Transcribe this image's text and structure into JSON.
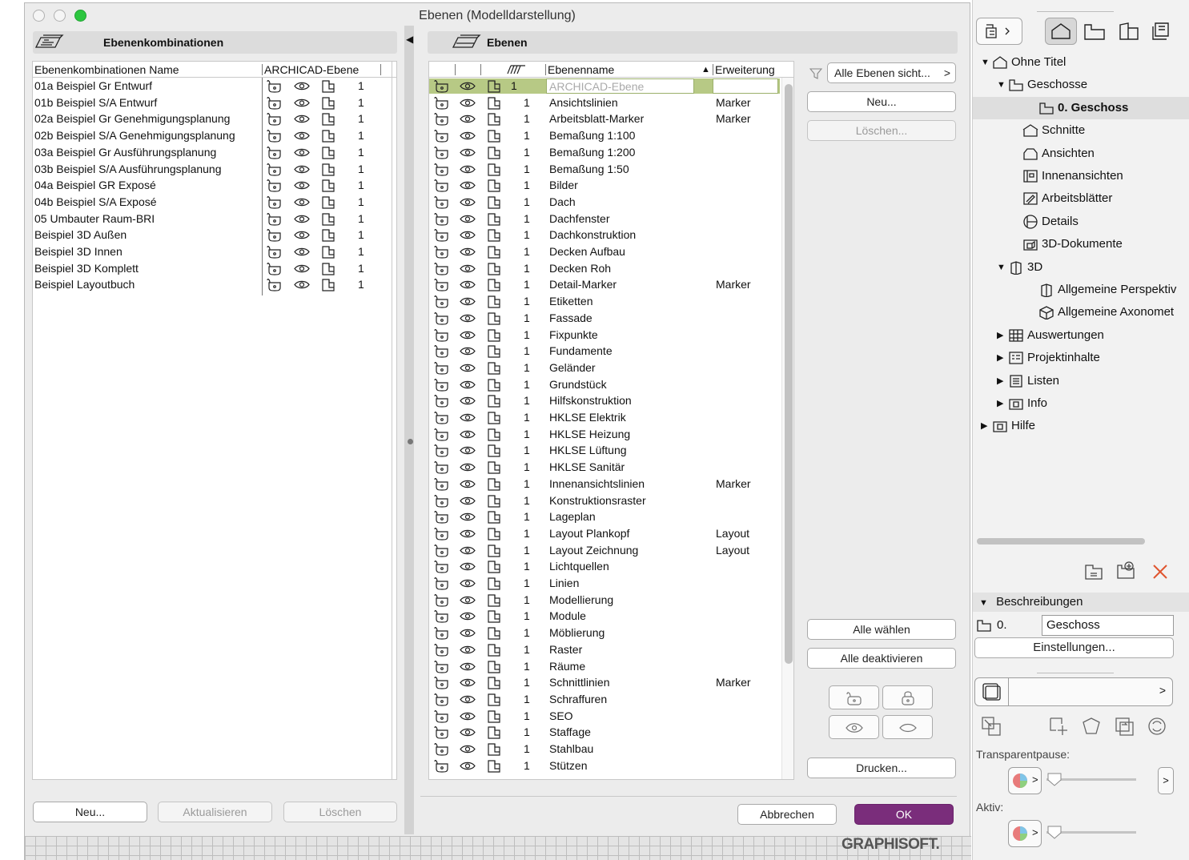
{
  "window": {
    "title": "Ebenen (Modelldarstellung)"
  },
  "left_panel": {
    "header": "Ebenenkombinationen",
    "columns": [
      "Ebenenkombinationen Name",
      "ARCHICAD-Ebene"
    ],
    "rows": [
      {
        "name": "01a Beispiel Gr Entwurf",
        "num": "1"
      },
      {
        "name": "01b Beispiel S/A Entwurf",
        "num": "1"
      },
      {
        "name": "02a Beispiel Gr Genehmigungsplanung",
        "num": "1"
      },
      {
        "name": "02b Beispiel S/A Genehmigungsplanung",
        "num": "1"
      },
      {
        "name": "03a Beispiel Gr Ausführungsplanung",
        "num": "1"
      },
      {
        "name": "03b Beispiel S/A Ausführungsplanung",
        "num": "1"
      },
      {
        "name": "04a Beispiel GR Exposé",
        "num": "1"
      },
      {
        "name": "04b Beispiel S/A Exposé",
        "num": "1"
      },
      {
        "name": "05 Umbauter Raum-BRI",
        "num": "1"
      },
      {
        "name": "Beispiel 3D Außen",
        "num": "1"
      },
      {
        "name": "Beispiel 3D Innen",
        "num": "1"
      },
      {
        "name": "Beispiel 3D Komplett",
        "num": "1"
      },
      {
        "name": "Beispiel Layoutbuch",
        "num": "1"
      }
    ],
    "buttons": {
      "new": "Neu...",
      "update": "Aktualisieren",
      "delete": "Löschen"
    }
  },
  "right_panel": {
    "header": "Ebenen",
    "columns": {
      "name": "Ebenenname",
      "sort": "▲",
      "ext": "Erweiterung"
    },
    "rows": [
      {
        "num": "1",
        "name": "ARCHICAD-Ebene",
        "ext": "",
        "selected": true
      },
      {
        "num": "1",
        "name": "Ansichtslinien",
        "ext": "Marker"
      },
      {
        "num": "1",
        "name": "Arbeitsblatt-Marker",
        "ext": "Marker"
      },
      {
        "num": "1",
        "name": "Bemaßung 1:100",
        "ext": ""
      },
      {
        "num": "1",
        "name": "Bemaßung 1:200",
        "ext": ""
      },
      {
        "num": "1",
        "name": "Bemaßung 1:50",
        "ext": ""
      },
      {
        "num": "1",
        "name": "Bilder",
        "ext": ""
      },
      {
        "num": "1",
        "name": "Dach",
        "ext": ""
      },
      {
        "num": "1",
        "name": "Dachfenster",
        "ext": ""
      },
      {
        "num": "1",
        "name": "Dachkonstruktion",
        "ext": ""
      },
      {
        "num": "1",
        "name": "Decken Aufbau",
        "ext": ""
      },
      {
        "num": "1",
        "name": "Decken Roh",
        "ext": ""
      },
      {
        "num": "1",
        "name": "Detail-Marker",
        "ext": "Marker"
      },
      {
        "num": "1",
        "name": "Etiketten",
        "ext": ""
      },
      {
        "num": "1",
        "name": "Fassade",
        "ext": ""
      },
      {
        "num": "1",
        "name": "Fixpunkte",
        "ext": ""
      },
      {
        "num": "1",
        "name": "Fundamente",
        "ext": ""
      },
      {
        "num": "1",
        "name": "Geländer",
        "ext": ""
      },
      {
        "num": "1",
        "name": "Grundstück",
        "ext": ""
      },
      {
        "num": "1",
        "name": "Hilfskonstruktion",
        "ext": ""
      },
      {
        "num": "1",
        "name": "HKLSE Elektrik",
        "ext": ""
      },
      {
        "num": "1",
        "name": "HKLSE Heizung",
        "ext": ""
      },
      {
        "num": "1",
        "name": "HKLSE Lüftung",
        "ext": ""
      },
      {
        "num": "1",
        "name": "HKLSE Sanitär",
        "ext": ""
      },
      {
        "num": "1",
        "name": "Innenansichtslinien",
        "ext": "Marker"
      },
      {
        "num": "1",
        "name": "Konstruktionsraster",
        "ext": ""
      },
      {
        "num": "1",
        "name": "Lageplan",
        "ext": ""
      },
      {
        "num": "1",
        "name": "Layout Plankopf",
        "ext": "Layout"
      },
      {
        "num": "1",
        "name": "Layout Zeichnung",
        "ext": "Layout"
      },
      {
        "num": "1",
        "name": "Lichtquellen",
        "ext": ""
      },
      {
        "num": "1",
        "name": "Linien",
        "ext": ""
      },
      {
        "num": "1",
        "name": "Modellierung",
        "ext": ""
      },
      {
        "num": "1",
        "name": "Module",
        "ext": ""
      },
      {
        "num": "1",
        "name": "Möblierung",
        "ext": ""
      },
      {
        "num": "1",
        "name": "Raster",
        "ext": ""
      },
      {
        "num": "1",
        "name": "Räume",
        "ext": ""
      },
      {
        "num": "1",
        "name": "Schnittlinien",
        "ext": "Marker"
      },
      {
        "num": "1",
        "name": "Schraffuren",
        "ext": ""
      },
      {
        "num": "1",
        "name": "SEO",
        "ext": ""
      },
      {
        "num": "1",
        "name": "Staffage",
        "ext": ""
      },
      {
        "num": "1",
        "name": "Stahlbau",
        "ext": ""
      },
      {
        "num": "1",
        "name": "Stützen",
        "ext": ""
      }
    ],
    "filter_button": "Alle Ebenen sicht...",
    "buttons": {
      "new": "Neu...",
      "delete": "Löschen...",
      "select_all": "Alle wählen",
      "deactivate_all": "Alle deaktivieren",
      "print": "Drucken...",
      "cancel": "Abbrechen",
      "ok": "OK"
    },
    "brand": "GRAPHISOFT."
  },
  "navigator": {
    "tree": [
      {
        "label": "Ohne Titel"
      },
      {
        "label": "Geschosse"
      },
      {
        "label": "0. Geschoss"
      },
      {
        "label": "Schnitte"
      },
      {
        "label": "Ansichten"
      },
      {
        "label": "Innenansichten"
      },
      {
        "label": "Arbeitsblätter"
      },
      {
        "label": "Details"
      },
      {
        "label": "3D-Dokumente"
      },
      {
        "label": "3D"
      },
      {
        "label": "Allgemeine Perspektiv"
      },
      {
        "label": "Allgemeine Axonomet"
      },
      {
        "label": "Auswertungen"
      },
      {
        "label": "Projektinhalte"
      },
      {
        "label": "Listen"
      },
      {
        "label": "Info"
      },
      {
        "label": "Hilfe"
      }
    ],
    "descriptions_header": "Beschreibungen",
    "story_number": "0.",
    "story_name": "Geschoss",
    "settings_button": "Einstellungen...",
    "transparent_label": "Transparentpause:",
    "active_label": "Aktiv:"
  },
  "colors": {
    "ok": "#7a2d7b",
    "selected_row": "#b7c985",
    "close_x": "#e0552f"
  }
}
